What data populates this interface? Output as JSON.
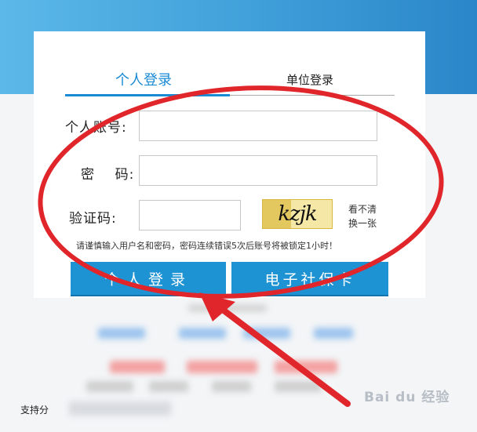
{
  "tabs": {
    "personal": "个人登录",
    "company": "单位登录"
  },
  "form": {
    "account_label": "个人账号:",
    "account_value": "",
    "password_label": "密    码:",
    "password_value": "",
    "captcha_label": "验证码:",
    "captcha_value": "",
    "captcha_text": "kzjk",
    "refresh_line1": "看不清",
    "refresh_line2": "换一张",
    "notice": "请谨慎输入用户名和密码，密码连续错误5次后账号将被锁定1小时！"
  },
  "buttons": {
    "login": "个人登录",
    "social_card": "电子社保卡"
  },
  "footer": {
    "text": "支持分"
  },
  "watermark": "Bai du 经验",
  "colors": {
    "accent": "#1a8ad4",
    "button": "#1e93d4",
    "annotation": "#e0262b"
  }
}
